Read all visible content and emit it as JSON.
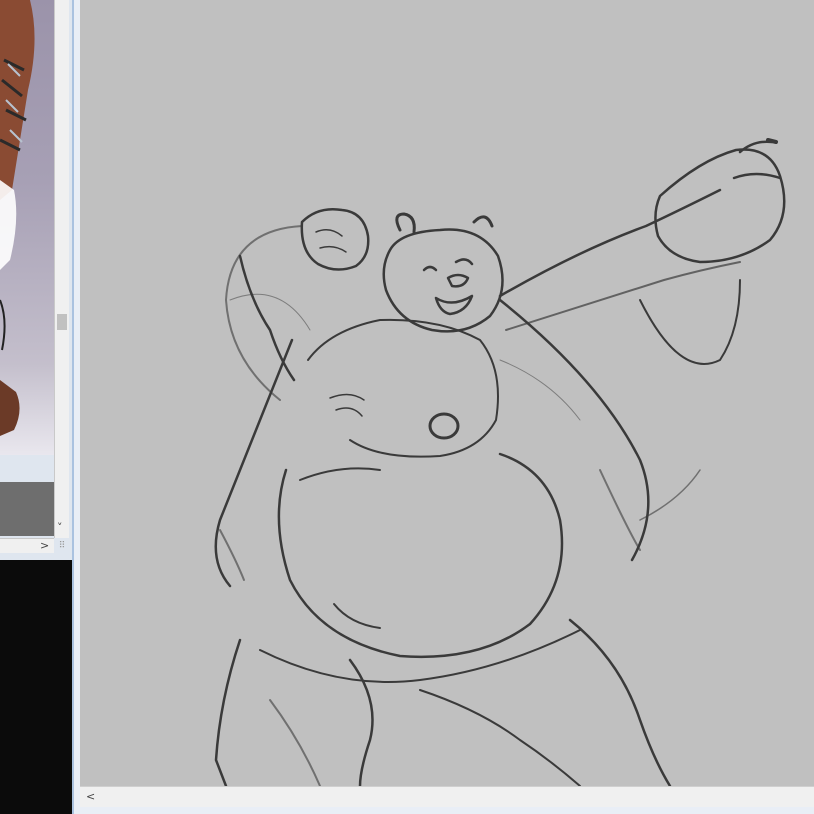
{
  "reference_panel": {
    "scroll_down_glyph": "˅",
    "scroll_right_glyph": ">",
    "resize_grip_glyph": "⠿"
  },
  "canvas": {
    "scroll_left_glyph": "<",
    "background_color": "#c0c0c0",
    "sketch_stroke_color": "#3a3a3a"
  },
  "colors": {
    "window_frame": "#aac2e0",
    "dark_panel": "#0b0b0b",
    "reference_bg": "#a7a0b5"
  }
}
